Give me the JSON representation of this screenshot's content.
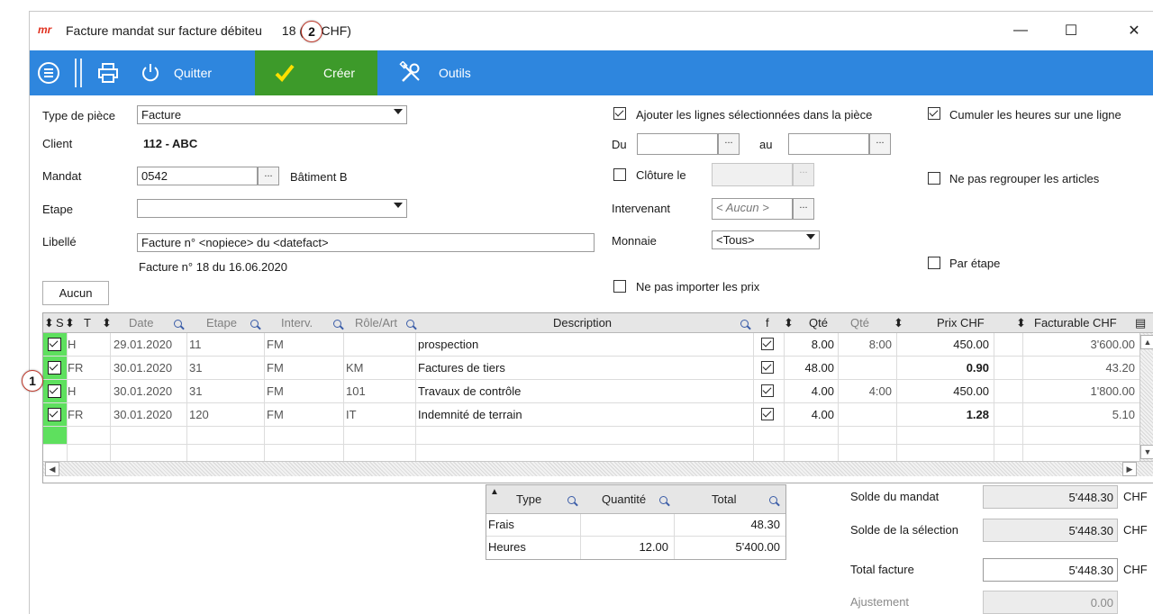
{
  "window": {
    "logo": "mr",
    "title": "Facture  mandat sur facture débiteu",
    "title_suffix": "18 (en CHF)",
    "minimize": "—",
    "maximize": "☐",
    "close": "✕"
  },
  "toolbar": {
    "quit_label": "Quitter",
    "create_label": "Créer",
    "tools_label": "Outils"
  },
  "form": {
    "type_label": "Type de pièce",
    "type_value": "Facture",
    "client_label": "Client",
    "client_value": "112  -  ABC",
    "mandat_label": "Mandat",
    "mandat_value": "0542",
    "mandat_name": "Bâtiment B",
    "etape_label": "Etape",
    "etape_value": "",
    "libelle_label": "Libellé",
    "libelle_value": "Facture n° <nopiece> du <datefact>",
    "libelle_preview": "Facture n° 18 du 16.06.2020",
    "aucun_label": "Aucun",
    "dots": "..."
  },
  "options": {
    "add_lines_label": "Ajouter les lignes sélectionnées dans la pièce",
    "add_lines_checked": true,
    "cumul_label": "Cumuler les heures sur une ligne",
    "cumul_checked": true,
    "du_label": "Du",
    "du_value": "",
    "au_label": "au",
    "au_value": "",
    "cloture_label": "Clôture le",
    "cloture_checked": false,
    "no_group_label": "Ne pas regrouper les articles",
    "no_group_checked": false,
    "intervenant_label": "Intervenant",
    "intervenant_value": "< Aucun >",
    "monnaie_label": "Monnaie",
    "monnaie_value": "<Tous>",
    "par_etape_label": "Par étape",
    "par_etape_checked": false,
    "no_price_label": "Ne pas importer les prix",
    "no_price_checked": false
  },
  "grid": {
    "headers": {
      "s": "S",
      "t": "T",
      "date": "Date",
      "etape": "Etape",
      "interv": "Interv.",
      "role": "Rôle/Art",
      "desc": "Description",
      "f": "f",
      "qte": "Qté",
      "qte2": "Qté",
      "prix": "Prix CHF",
      "fact": "Facturable CHF"
    },
    "rows": [
      {
        "selected": true,
        "t": "H",
        "date": "29.01.2020",
        "etape": "11",
        "interv": "FM",
        "role": "",
        "desc": "prospection",
        "f": true,
        "qte": "8.00",
        "qte2": "8:00",
        "prix": "450.00",
        "prix_bold": false,
        "fact": "3'600.00"
      },
      {
        "selected": true,
        "t": "FR",
        "date": "30.01.2020",
        "etape": "31",
        "interv": "FM",
        "role": "KM",
        "desc": "Factures de tiers",
        "f": true,
        "qte": "48.00",
        "qte2": "",
        "prix": "0.90",
        "prix_bold": true,
        "fact": "43.20"
      },
      {
        "selected": true,
        "t": "H",
        "date": "30.01.2020",
        "etape": "31",
        "interv": "FM",
        "role": "101",
        "desc": "Travaux de contrôle",
        "f": true,
        "qte": "4.00",
        "qte2": "4:00",
        "prix": "450.00",
        "prix_bold": false,
        "fact": "1'800.00"
      },
      {
        "selected": true,
        "t": "FR",
        "date": "30.01.2020",
        "etape": "120",
        "interv": "FM",
        "role": "IT",
        "desc": "Indemnité de terrain",
        "f": true,
        "qte": "4.00",
        "qte2": "",
        "prix": "1.28",
        "prix_bold": true,
        "fact": "5.10"
      }
    ]
  },
  "summary": {
    "headers": {
      "type": "Type",
      "qty": "Quantité",
      "total": "Total"
    },
    "rows": [
      {
        "type": "Frais",
        "qty": "",
        "total": "48.30"
      },
      {
        "type": "Heures",
        "qty": "12.00",
        "total": "5'400.00"
      }
    ]
  },
  "totals": {
    "solde_mandat_label": "Solde du mandat",
    "solde_mandat": "5'448.30",
    "solde_sel_label": "Solde de la sélection",
    "solde_sel": "5'448.30",
    "total_label": "Total facture",
    "total": "5'448.30",
    "ajust_label": "Ajustement",
    "ajust": "0.00",
    "currency": "CHF"
  },
  "callouts": {
    "one": "1",
    "two": "2"
  },
  "colors": {
    "toolbar": "#2e86de",
    "create": "#3d9a2a",
    "selection": "#5ee05e"
  }
}
